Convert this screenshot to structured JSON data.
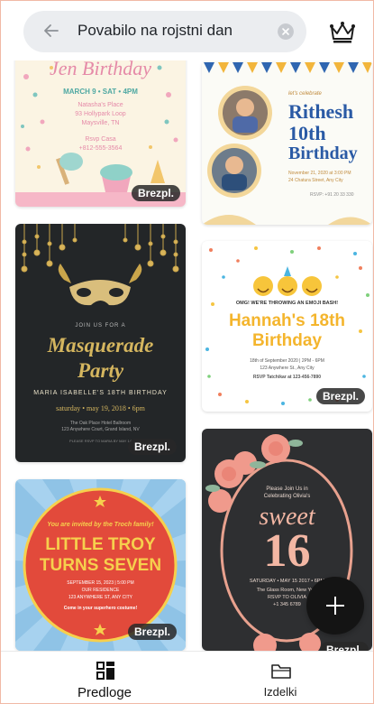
{
  "search": {
    "query": "Povabilo na rojstni dan"
  },
  "icons": {
    "back": "back-arrow-icon",
    "clear": "clear-icon",
    "premium": "crown-icon",
    "templates": "templates-grid-icon",
    "designs": "folder-icon",
    "add": "plus-icon"
  },
  "templates": [
    {
      "badge": "Brezpl.",
      "title": "Jen Birthday",
      "date": "MARCH 9 • SAT • 4PM",
      "place1": "Natasha's Place",
      "place2": "93 Hollypark Loop",
      "place3": "Maysville, TN",
      "rsvp": "Rsvp Casa",
      "phone": "+812-555-3564"
    },
    {
      "badge": "",
      "kicker": "let's celebrate",
      "title1": "Rithesh",
      "title2": "10th",
      "title3": "Birthday",
      "line1": "November 21, 2020 at 3:00 PM",
      "line2": "24 Chatura Street, Any City",
      "rsvp": "RSVP: +91 20 33 330"
    },
    {
      "badge": "Brezpl.",
      "kicker": "JOIN US FOR A",
      "title1": "Masquerade",
      "title2": "Party",
      "sub": "MARIA ISABELLE'S 18TH BIRTHDAY",
      "date": "saturday • may 19, 2018 • 6pm",
      "place1": "The Oak Place Hotel Ballroom",
      "place2": "123 Anywhere Court, Grand Island, NV",
      "rsvp": "PLEASE RSVP TO MARIA BY MAY 14"
    },
    {
      "badge": "Brezpl.",
      "kicker": "OMG! WE'RE THROWING AN EMOJI BASH!",
      "title1": "Hannah's 18th",
      "title2": "Birthday",
      "date": "18th of September 2020 | 2PM - 6PM",
      "place": "123 Anywhere St., Any City",
      "rsvp": "RSVP Tatchikar at 123-456-7890"
    },
    {
      "badge": "Brezpl.",
      "kicker": "You are invited by the Troch family!",
      "title1": "LITTLE TROY",
      "title2": "TURNS SEVEN",
      "date": "SEPTEMBER 15, 2023 | 5:00 PM",
      "place1": "OUR RESIDENCE",
      "place2": "123 ANYWHERE ST, ANY CITY",
      "note": "Come in your superhero costume!"
    },
    {
      "badge": "Brezpl.",
      "kicker1": "Please Join Us in",
      "kicker2": "Celebrating Olivia's",
      "script": "sweet",
      "number": "16",
      "date": "SATURDAY • MAY 15 2017 • 6PM",
      "place1": "The Glass Room, New York",
      "place2": "RSVP TO OLIVIA",
      "phone": "+1 345 6789"
    }
  ],
  "nav": {
    "templates_label": "Predloge",
    "designs_label": "Izdelki"
  }
}
